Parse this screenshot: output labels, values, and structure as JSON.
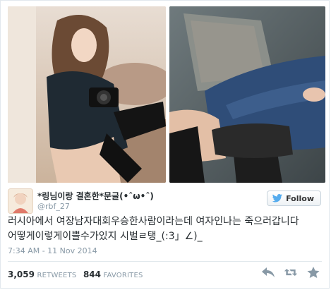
{
  "tweet": {
    "display_name": "*링님이랑 결혼한*문글(•ˆω•ˆ)",
    "handle": "@rbf_27",
    "text_lines": [
      "러시아에서 여장남자대회우승한사람이라는데 여자인나는 죽으러갑니다",
      "어떻게이렇게이쁠수가있지 시벌ㄹ탱_(:3」∠)_"
    ],
    "timestamp": "7:34 AM - 11 Nov 2014"
  },
  "follow_button": {
    "label": "Follow",
    "icon": "twitter-bird-icon"
  },
  "stats": {
    "retweets_count": "3,059",
    "retweets_label": "RETWEETS",
    "favorites_count": "844",
    "favorites_label": "FAVORITES"
  },
  "actions": [
    "reply-icon",
    "retweet-icon",
    "favorite-icon"
  ],
  "colors": {
    "accent": "#55acee",
    "text": "#292f33",
    "muted": "#8899a6",
    "border": "#e1e8ed"
  }
}
